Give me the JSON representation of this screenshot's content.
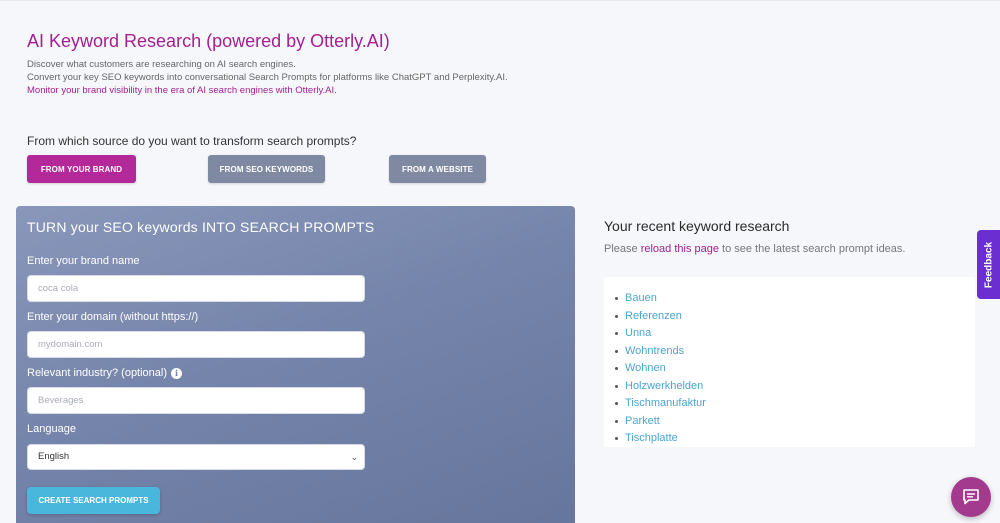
{
  "header": {
    "title": "AI Keyword Research (powered by Otterly.AI)",
    "line1": "Discover what customers are researching on AI search engines.",
    "line2": "Convert your key SEO keywords into conversational Search Prompts for platforms like ChatGPT and Perplexity.AI.",
    "link": "Monitor your brand visibility in the era of AI search engines with Otterly.AI."
  },
  "source": {
    "question": "From which source do you want to transform search prompts?",
    "buttons": {
      "brand": "FROM YOUR BRAND",
      "seo": "FROM SEO KEYWORDS",
      "website": "FROM A WEBSITE"
    }
  },
  "form": {
    "title": "TURN your SEO keywords INTO SEARCH PROMPTS",
    "brand_label": "Enter your brand name",
    "brand_placeholder": "coca cola",
    "domain_label": "Enter your domain (without https://)",
    "domain_placeholder": "mydomain.com",
    "industry_label": "Relevant industry? (optional)",
    "industry_placeholder": "Beverages",
    "language_label": "Language",
    "language_value": "English",
    "submit": "CREATE SEARCH PROMPTS"
  },
  "recent": {
    "title": "Your recent keyword research",
    "hint_before": "Please ",
    "hint_link": "reload this page",
    "hint_after": " to see the latest search prompt ideas.",
    "items": [
      "Bauen",
      "Referenzen",
      "Unna",
      "Wohntrends",
      "Wohnen",
      "Holzwerkhelden",
      "Tischmanufaktur",
      "Parkett",
      "Tischplatte"
    ]
  },
  "feedback": {
    "label": "Feedback"
  },
  "colors": {
    "brand": "#a3218f",
    "button_active": "#b4299a",
    "button_inactive": "#7f8aa2",
    "cta": "#49b6dc",
    "link": "#49a6cf",
    "feedback": "#6b2fd1"
  },
  "icons": {
    "info": "info-icon",
    "chevron": "chevron-down-icon",
    "chat": "chat-icon"
  }
}
